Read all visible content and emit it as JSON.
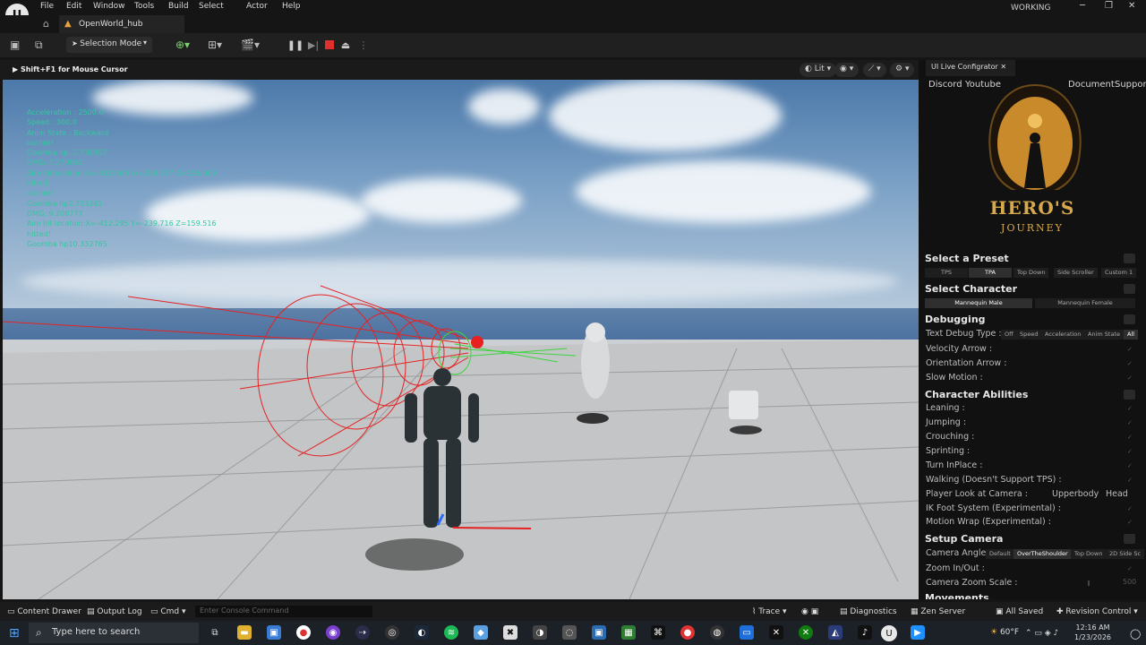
{
  "menubar": {
    "items": [
      "File",
      "Edit",
      "Window",
      "Tools",
      "Build",
      "Select",
      "Actor",
      "Help"
    ],
    "status": "WORKING"
  },
  "tab": {
    "project_name": "OpenWorld_hub"
  },
  "toolbar": {
    "selection_mode": "Selection Mode"
  },
  "viewport": {
    "hint": "Shift+F1 for Mouse Cursor",
    "view_mode": "Lit",
    "debug_lines": [
      "Acceleration : 2500.0",
      "Speed : 300.0",
      "Anim State : Backward",
      "ouchie!",
      "Goomba hp: 2.730857",
      "DMG: 7.270862",
      "Aim hit location:X=-412.460 Y=-239.277 Z=155.009",
      "hitted!",
      "ouchie!",
      "Goomba hp2.733261",
      "DMG: 9.208777",
      "Aim hit location:X=-412.295 Y=-239.716 Z=159.516",
      "hitted!",
      "Goomba hp10.332765"
    ]
  },
  "panel": {
    "tab_title": "UI Live Configrator",
    "links": [
      "Discord",
      "Youtube",
      "Document",
      "Suppor"
    ],
    "emblem_title": "HERO'S",
    "emblem_sub": "JOURNEY",
    "preset": {
      "title": "Select a Preset",
      "options": [
        "TPS",
        "TPA",
        "Top Down",
        "Side Scroller",
        "Custom 1"
      ]
    },
    "character": {
      "title": "Select Character",
      "options": [
        "Mannequin Male",
        "Mannequin Female"
      ]
    },
    "debugging": {
      "title": "Debugging",
      "text_debug_label": "Text Debug Type :",
      "text_debug_options": [
        "Off",
        "Speed",
        "Acceleration",
        "Anim State",
        "All"
      ],
      "rows": [
        "Velocity Arrow :",
        "Orientation Arrow :",
        "Slow Motion :"
      ]
    },
    "abilities": {
      "title": "Character Abilities",
      "rows": [
        "Leaning :",
        "Jumping :",
        "Crouching :",
        "Sprinting :",
        "Turn InPlace :",
        "Walking (Doesn't Support TPS) :",
        "Player Look at Camera :",
        "IK Foot System (Experimental) :",
        "Motion Wrap (Experimental) :"
      ],
      "look_options": [
        "Upperbody",
        "Head"
      ]
    },
    "camera": {
      "title": "Setup Camera",
      "angle_label": "Camera Angle :",
      "angle_options": [
        "Default",
        "OverTheShoulder",
        "Top Down",
        "2D Side Sc"
      ],
      "rows": [
        "Zoom In/Out :",
        "Camera Zoom Scale :"
      ],
      "zoom_value": "500"
    },
    "movements_title": "Movements"
  },
  "bottombar": {
    "content_drawer": "Content Drawer",
    "output_log": "Output Log",
    "cmd": "Cmd",
    "console_placeholder": "Enter Console Command",
    "trace": "Trace",
    "diagnostics": "Diagnostics",
    "zen_server": "Zen Server",
    "all_saved": "All Saved",
    "revision_control": "Revision Control"
  },
  "taskbar": {
    "search_placeholder": "Type here to search",
    "weather": "60°F",
    "time": "12:16 AM",
    "date": "1/23/2026"
  }
}
